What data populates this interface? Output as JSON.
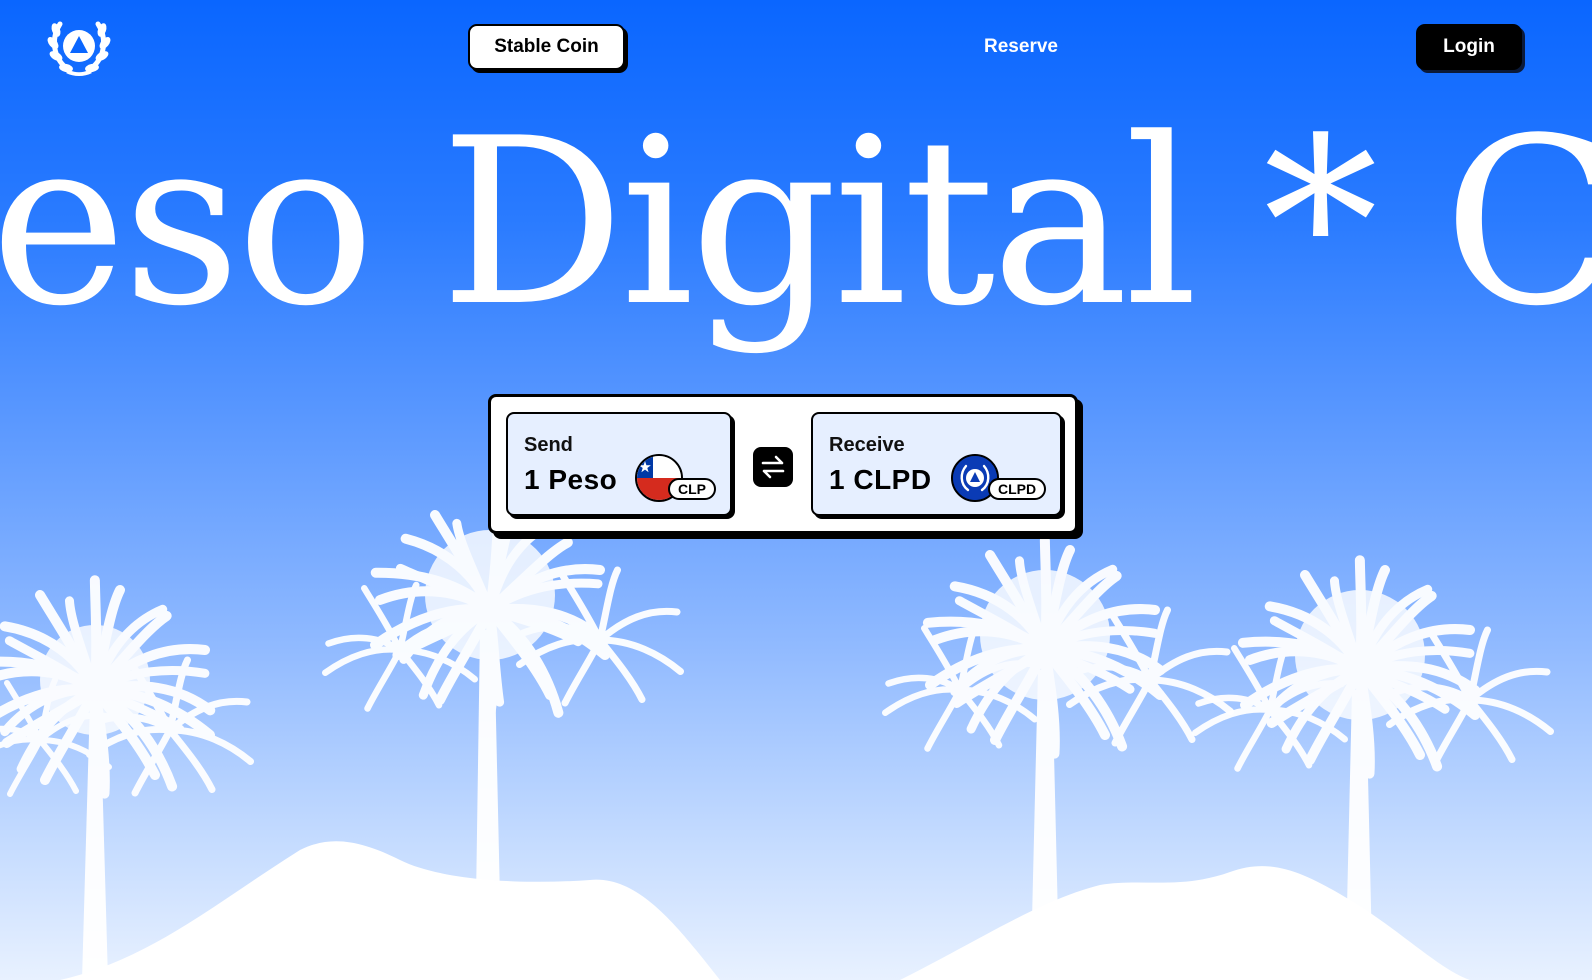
{
  "header": {
    "logo_icon": "laurel-triangle-icon",
    "nav": {
      "stable_coin": "Stable Coin",
      "reserve": "Reserve",
      "login": "Login"
    }
  },
  "hero": {
    "marquee_text": "Peso Digital * CLPD"
  },
  "swap": {
    "send": {
      "label": "Send",
      "amount": "1 Peso",
      "ticker": "CLP",
      "icon": "chile-flag-icon"
    },
    "swap_icon": "swap-arrows-icon",
    "receive": {
      "label": "Receive",
      "amount": "1 CLPD",
      "ticker": "CLPD",
      "icon": "clpd-coin-icon"
    }
  },
  "colors": {
    "brand_blue": "#0a66ff",
    "flag_red": "#d52b1e",
    "flag_blue": "#0039a6",
    "coin_blue": "#0a3bb5"
  }
}
